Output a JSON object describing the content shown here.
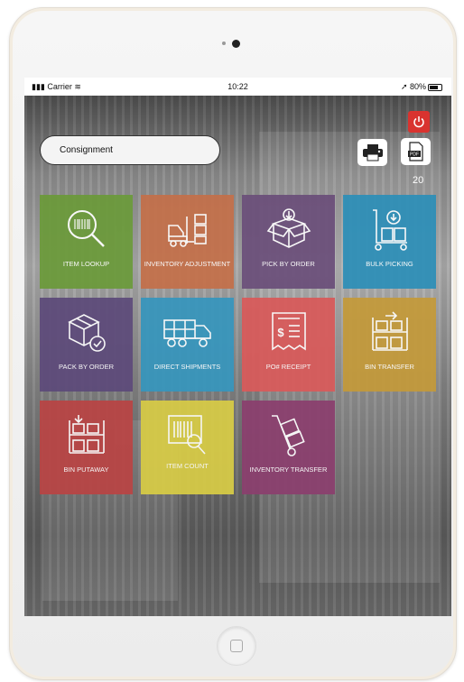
{
  "status": {
    "carrier": "Carrier",
    "time": "10:22",
    "battery": "80%"
  },
  "search": {
    "value": "Consignment"
  },
  "toolbar": {
    "badge_count": "20"
  },
  "tiles": [
    {
      "label": "ITEM LOOKUP",
      "color": "#6b9a3a"
    },
    {
      "label": "INVENTORY ADJUSTMENT",
      "color": "#c4704a"
    },
    {
      "label": "PICK BY ORDER",
      "color": "#6b4f7a"
    },
    {
      "label": "BULK PICKING",
      "color": "#2d8fb8"
    },
    {
      "label": "PACK BY ORDER",
      "color": "#5d4a7a"
    },
    {
      "label": "DIRECT SHIPMENTS",
      "color": "#3796bd"
    },
    {
      "label": "PO# RECEIPT",
      "color": "#d95a5a"
    },
    {
      "label": "BIN TRANSFER",
      "color": "#c49a3a"
    },
    {
      "label": "BIN PUTAWAY",
      "color": "#b94444"
    },
    {
      "label": "ITEM COUNT",
      "color": "#d8cc46"
    },
    {
      "label": "INVENTORY TRANSFER",
      "color": "#8b3f6e"
    }
  ]
}
